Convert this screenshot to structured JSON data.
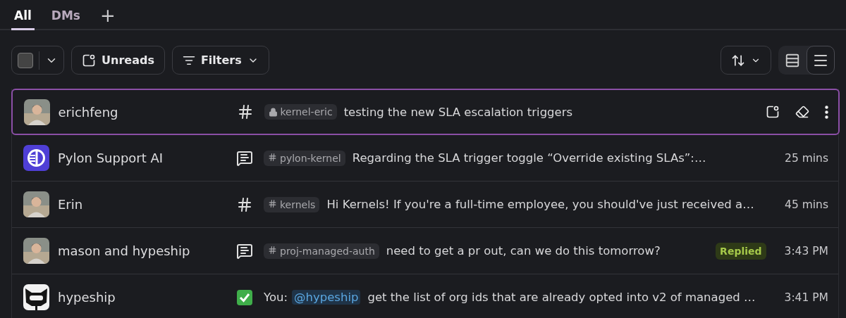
{
  "tabs": [
    {
      "label": "All",
      "selected": true
    },
    {
      "label": "DMs",
      "selected": false
    }
  ],
  "add_tab": "+",
  "toolbar": {
    "select_all": {
      "checked": false
    },
    "unreads": "Unreads",
    "filters": "Filters",
    "view_modes": [
      {
        "kind": "comfortable",
        "selected": false
      },
      {
        "kind": "compact",
        "selected": true
      }
    ]
  },
  "rows": [
    {
      "name": "erichfeng",
      "type_icon": {
        "kind": "hash"
      },
      "channel": {
        "name": "kernel-eric",
        "private": true
      },
      "message": {
        "text": "testing the new SLA escalation triggers"
      },
      "selected": true
    },
    {
      "name": "Pylon Support AI",
      "avatar": {
        "kind": "logo"
      },
      "type_icon": {
        "kind": "thread"
      },
      "channel": {
        "name": "pylon-kernel",
        "private": false
      },
      "message": {
        "text": "Regarding the SLA trigger toggle “Override existing SLAs”:…"
      },
      "time": "25 mins",
      "selected": false
    },
    {
      "name": "Erin",
      "type_icon": {
        "kind": "hash"
      },
      "channel": {
        "name": "kernels",
        "private": false
      },
      "message": {
        "text": "Hi Kernels! If you're a full-time employee, you should've just received a…"
      },
      "time": "45 mins",
      "selected": false
    },
    {
      "name": "mason and hypeship",
      "type_icon": {
        "kind": "thread"
      },
      "channel": {
        "name": "proj-managed-auth",
        "private": false
      },
      "message": {
        "text": "need to get a pr out, can we do this tomorrow?"
      },
      "badge": "Replied",
      "time": "3:43 PM",
      "selected": false
    },
    {
      "name": "hypeship",
      "avatar": {
        "kind": "robot"
      },
      "type_icon": {
        "kind": "check"
      },
      "message": {
        "prefix": "You:",
        "mention": "@hypeship",
        "text": "get the list of org ids that are already opted into v2 of managed …"
      },
      "time": "3:41 PM",
      "selected": false
    }
  ]
}
